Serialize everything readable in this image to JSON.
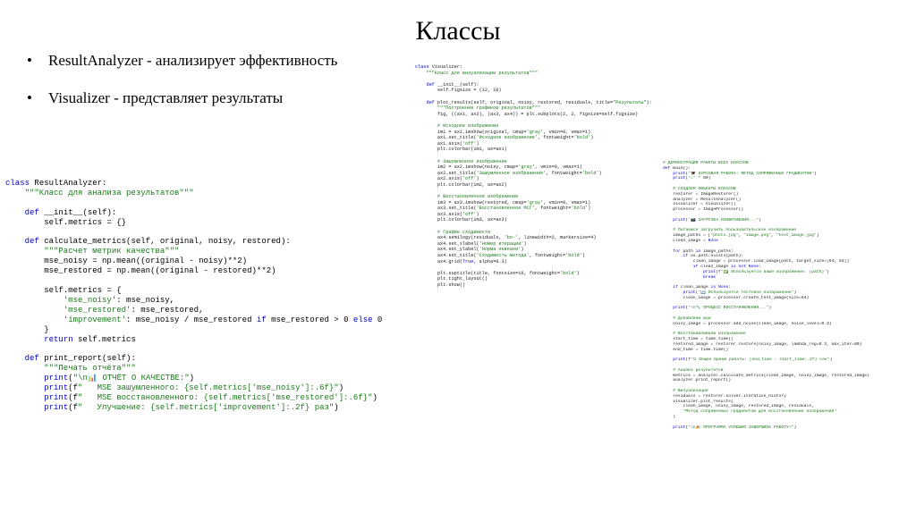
{
  "slide": {
    "title": "Классы",
    "bullet_marker": "•",
    "bullets": [
      "ResultAnalyzer - анализирует эффективность",
      "Visualizer - представляет результаты"
    ]
  },
  "code_left": [
    "class ResultAnalyzer:",
    "    \"\"\"Класс для анализа результатов\"\"\"",
    "",
    "    def __init__(self):",
    "        self.metrics = {}",
    "",
    "    def calculate_metrics(self, original, noisy, restored):",
    "        \"\"\"Расчет метрик качества\"\"\"",
    "        mse_noisy = np.mean((original - noisy)**2)",
    "        mse_restored = np.mean((original - restored)**2)",
    "",
    "        self.metrics = {",
    "            'mse_noisy': mse_noisy,",
    "            'mse_restored': mse_restored,",
    "            'improvement': mse_noisy / mse_restored if mse_restored > 0 else 0",
    "        }",
    "        return self.metrics",
    "",
    "    def print_report(self):",
    "        \"\"\"Печать отчёта\"\"\"",
    "        print(\"\\n📊 ОТЧЁТ О КАЧЕСТВЕ:\")",
    "        print(f\"   MSE зашумленного: {self.metrics['mse_noisy']:.6f}\")",
    "        print(f\"   MSE восстановленного: {self.metrics['mse_restored']:.6f}\")",
    "        print(f\"   Улучшение: {self.metrics['improvement']:.2f} раз\")"
  ],
  "code_top": [
    "class Visualizer:",
    "    \"\"\"Класс для визуализации результатов\"\"\"",
    "",
    "    def __init__(self):",
    "        self.figsize = (12, 10)",
    "",
    "    def plot_results(self, original, noisy, restored, residuals, title=\"Результаты\"):",
    "        \"\"\"Построение графиков результатов\"\"\"",
    "        fig, ((ax1, ax2), (ax3, ax4)) = plt.subplots(2, 2, figsize=self.figsize)",
    "",
    "        # Исходное изображение",
    "        im1 = ax1.imshow(original, cmap='gray', vmin=0, vmax=1)",
    "        ax1.set_title('Исходное изображение', fontweight='bold')",
    "        ax1.axis('off')",
    "        plt.colorbar(im1, ax=ax1)",
    "",
    "        # Зашумленное изображение",
    "        im2 = ax2.imshow(noisy, cmap='gray', vmin=0, vmax=1)",
    "        ax2.set_title('Зашумленное изображение', fontweight='bold')",
    "        ax2.axis('off')",
    "        plt.colorbar(im2, ax=ax2)",
    "",
    "        # Восстановленное изображение",
    "        im3 = ax3.imshow(restored, cmap='gray', vmin=0, vmax=1)",
    "        ax3.set_title('Восстановленное МСГ', fontweight='bold')",
    "        ax3.axis('off')",
    "        plt.colorbar(im3, ax=ax3)",
    "",
    "        # График сходимости",
    "        ax4.semilogy(residuals, 'bo-', linewidth=2, markersize=4)",
    "        ax4.set_xlabel('Номер итерации')",
    "        ax4.set_ylabel('Норма невязки')",
    "        ax4.set_title('Сходимость метода', fontweight='bold')",
    "        ax4.grid(True, alpha=0.3)",
    "",
    "        plt.suptitle(title, fontsize=16, fontweight='bold')",
    "        plt.tight_layout()",
    "        plt.show()"
  ],
  "code_right": [
    "# ДЕМОНСТРАЦИЯ РАБОТЫ ВСЕХ КЛАССОВ",
    "def main():",
    "    print(\"🎓 КУРСОВАЯ РАБОТА: МЕТОД СОПРЯЖЁННЫХ ГРАДИЕНТОВ\")",
    "    print(\"=\" * 60)",
    "",
    "    # СОЗДАЁМ ОБЪЕКТЫ КЛАССОВ",
    "    restorer = ImageRestorer()",
    "    analyzer = ResultAnalyzer()",
    "    visualizer = Visualizer()",
    "    processor = ImageProcessor()",
    "",
    "    print(\"📷 ЗАГРУЗКА ИЗОБРАЖЕНИЯ...\")",
    "",
    "    # Пытаемся загрузить пользовательское изображение",
    "    image_paths = [\"photo.jpg\", \"image.png\", \"test_image.jpg\"]",
    "    clean_image = None",
    "",
    "    for path in image_paths:",
    "        if os.path.exists(path):",
    "            clean_image = processor.load_image(path, target_size=(64, 64))",
    "            if clean_image is not None:",
    "                print(f\"✅ Используется ваше изображение: {path}\")",
    "                break",
    "",
    "    if clean_image is None:",
    "        print(\"🔄 Используется тестовое изображение\")",
    "        clean_image = processor.create_test_image(size=64)",
    "",
    "    print(\"\\n🔧 ПРОЦЕСС ВОССТАНОВЛЕНИЯ...\")",
    "",
    "    # Добавляем шум",
    "    noisy_image = processor.add_noise(clean_image, noise_level=0.3)",
    "",
    "    # Восстанавливаем изображение",
    "    start_time = time.time()",
    "    restored_image = restorer.restore(noisy_image, lambda_reg=0.3, max_iter=80)",
    "    end_time = time.time()",
    "",
    "    print(f\"⏱ Общее время работы: {end_time - start_time:.2f} сек\")",
    "",
    "    # Анализ результатов",
    "    metrics = analyzer.calculate_metrics(clean_image, noisy_image, restored_image)",
    "    analyzer.print_report()",
    "",
    "    # Визуализация",
    "    residuals = restorer.solver.iteration_history",
    "    visualizer.plot_results(",
    "        clean_image, noisy_image, restored_image, residuals,",
    "        \"Метод сопряжённых градиентов для восстановления изображений\"",
    "    )",
    "",
    "    print(\"\\n🎉 ПРОГРАММА УСПЕШНО ЗАВЕРШИЛА РАБОТУ!\")"
  ]
}
